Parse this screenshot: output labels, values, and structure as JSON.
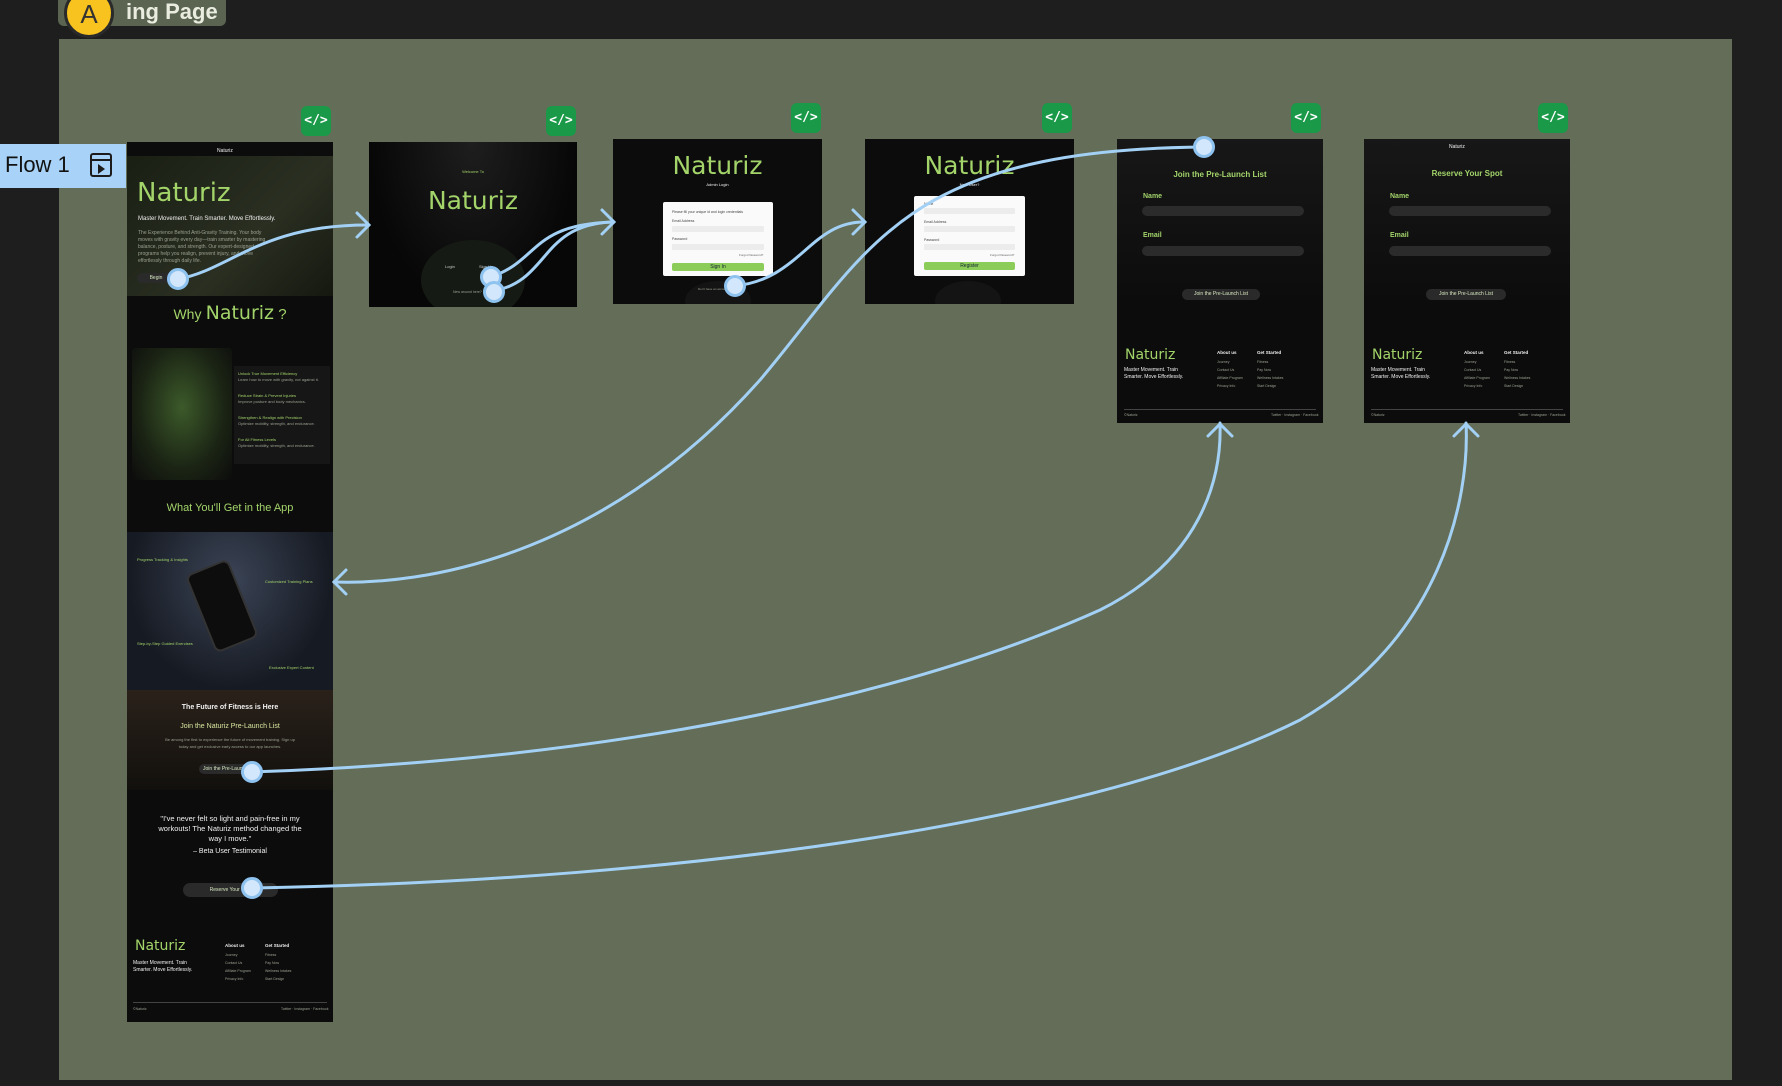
{
  "canvas": {
    "section_title": "ing Page",
    "avatar_initial": "A",
    "flow_label": "Flow 1"
  },
  "code_badge_label": "</>",
  "landing": {
    "nav_brand": "Naturiz",
    "hero_title": "Naturiz",
    "hero_subtitle": "Master Movement. Train Smarter. Move Effortlessly.",
    "hero_desc": "The Experience Behind Anti-Gravity Training. Your body moves with gravity every day—train smarter by mastering balance, posture, and strength. Our expert-designed programs help you realign, prevent injury, and move effortlessly through daily life.",
    "hero_button": "Begin",
    "why_prefix": "Why",
    "why_brand": "Naturiz",
    "why_suffix": "?",
    "features": [
      {
        "title": "Unlock True Movement Efficiency",
        "desc": "Learn how to move with gravity, not against it."
      },
      {
        "title": "Reduce Strain & Prevent Injuries",
        "desc": "Improve posture and body mechanics."
      },
      {
        "title": "Strengthen & Realign with Precision",
        "desc": "Optimize mobility, strength, and endurance."
      },
      {
        "title": "For All Fitness Levels",
        "desc": "Optimize mobility, strength, and endurance."
      }
    ],
    "app_heading": "What You'll Get in the App",
    "app_callouts": [
      "Progress Tracking & Insights",
      "Customized Training Plans",
      "Step-by-Step Guided Exercises",
      "Exclusive Expert Content"
    ],
    "future_title": "The Future of Fitness is Here",
    "future_subtitle": "Join the Naturiz Pre-Launch List",
    "future_desc": "Be among the first to experience the future of movement training. Sign up today and get exclusive early access to our app launches.",
    "future_button": "Join the Pre-Launch List",
    "testimonial": "\"I've never felt so light and pain-free in my workouts! The Naturiz method changed the way I move.\"",
    "testimonial_author": "– Beta User Testimonial",
    "reserve_button": "Reserve Your Spot",
    "footer": {
      "brand": "Naturiz",
      "tagline": "Master Movement. Train Smarter. Move Effortlessly.",
      "col1_title": "About us",
      "col1_items": [
        "Journey",
        "Contact Us",
        "Affiliate Program",
        "Privacy Info"
      ],
      "col2_title": "Get Started",
      "col2_items": [
        "Fitness",
        "Pay Now",
        "Wellness Intakes",
        "Start Design"
      ],
      "copyright": "©Naturiz",
      "social": "Twitter · Instagram · Facebook"
    }
  },
  "splash": {
    "welcome": "Welcome To",
    "brand": "Naturiz",
    "button_1": "Login",
    "button_2": "Sign Up",
    "note": "New around here?"
  },
  "login": {
    "brand": "Naturiz",
    "subtitle": "Admin Login",
    "card_heading": "Please fill your unique id and login credentials",
    "email_label": "Email Address",
    "password_label": "Password",
    "forgot": "Forgot Password?",
    "button": "Sign In",
    "footer": "Don't have an account?"
  },
  "register": {
    "brand": "Naturiz",
    "subtitle": "New User?",
    "name_label": "Name",
    "email_label": "Email Address",
    "password_label": "Password",
    "forgot": "Forgot Password?",
    "button": "Register"
  },
  "prelaunch": {
    "title": "Join the Pre-Launch List",
    "name_label": "Name",
    "email_label": "Email",
    "button": "Join the Pre-Launch List"
  },
  "reserve": {
    "nav_brand": "Naturiz",
    "title": "Reserve Your Spot",
    "name_label": "Name",
    "email_label": "Email",
    "button": "Join the Pre-Launch List"
  }
}
